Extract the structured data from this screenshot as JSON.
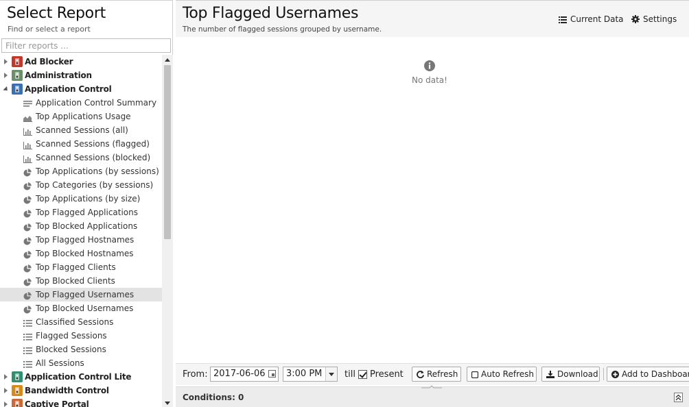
{
  "left": {
    "title": "Select Report",
    "subtitle": "Find or select a report",
    "filter_placeholder": "Filter reports ..."
  },
  "tree": [
    {
      "type": "group",
      "label": "Ad Blocker",
      "expanded": false,
      "icon": "ad-blocker-icon",
      "color": "#c0392b"
    },
    {
      "type": "group",
      "label": "Administration",
      "expanded": false,
      "icon": "administration-icon",
      "color": "#6b8e6b"
    },
    {
      "type": "group",
      "label": "Application Control",
      "expanded": true,
      "icon": "application-control-icon",
      "color": "#3a6fb0"
    },
    {
      "type": "report",
      "label": "Application Control Summary",
      "icon": "text-report-icon"
    },
    {
      "type": "report",
      "label": "Top Applications Usage",
      "icon": "area-chart-icon"
    },
    {
      "type": "report",
      "label": "Scanned Sessions (all)",
      "icon": "bar-chart-icon"
    },
    {
      "type": "report",
      "label": "Scanned Sessions (flagged)",
      "icon": "bar-chart-icon"
    },
    {
      "type": "report",
      "label": "Scanned Sessions (blocked)",
      "icon": "bar-chart-icon"
    },
    {
      "type": "report",
      "label": "Top Applications (by sessions)",
      "icon": "pie-chart-icon"
    },
    {
      "type": "report",
      "label": "Top Categories (by sessions)",
      "icon": "pie-chart-icon"
    },
    {
      "type": "report",
      "label": "Top Applications (by size)",
      "icon": "pie-chart-icon"
    },
    {
      "type": "report",
      "label": "Top Flagged Applications",
      "icon": "pie-chart-icon"
    },
    {
      "type": "report",
      "label": "Top Blocked Applications",
      "icon": "pie-chart-icon"
    },
    {
      "type": "report",
      "label": "Top Flagged Hostnames",
      "icon": "pie-chart-icon"
    },
    {
      "type": "report",
      "label": "Top Blocked Hostnames",
      "icon": "pie-chart-icon"
    },
    {
      "type": "report",
      "label": "Top Flagged Clients",
      "icon": "pie-chart-icon"
    },
    {
      "type": "report",
      "label": "Top Blocked Clients",
      "icon": "pie-chart-icon"
    },
    {
      "type": "report",
      "label": "Top Flagged Usernames",
      "icon": "pie-chart-icon",
      "selected": true
    },
    {
      "type": "report",
      "label": "Top Blocked Usernames",
      "icon": "pie-chart-icon"
    },
    {
      "type": "report",
      "label": "Classified Sessions",
      "icon": "list-icon"
    },
    {
      "type": "report",
      "label": "Flagged Sessions",
      "icon": "list-icon"
    },
    {
      "type": "report",
      "label": "Blocked Sessions",
      "icon": "list-icon"
    },
    {
      "type": "report",
      "label": "All Sessions",
      "icon": "list-icon"
    },
    {
      "type": "group",
      "label": "Application Control Lite",
      "expanded": false,
      "icon": "application-control-lite-icon",
      "color": "#2f8f6f"
    },
    {
      "type": "group",
      "label": "Bandwidth Control",
      "expanded": false,
      "icon": "bandwidth-control-icon",
      "color": "#d68a1c"
    },
    {
      "type": "group",
      "label": "Captive Portal",
      "expanded": false,
      "icon": "captive-portal-icon",
      "color": "#c86a3a"
    }
  ],
  "report": {
    "title": "Top Flagged Usernames",
    "description": "The number of flagged sessions grouped by username.",
    "current_data_label": "Current Data",
    "settings_label": "Settings",
    "no_data": "No data!"
  },
  "toolbar": {
    "from_label": "From:",
    "date_value": "2017-06-06",
    "time_value": "3:00 PM",
    "till_label": "till",
    "present_label": "Present",
    "present_checked": true,
    "refresh_label": "Refresh",
    "auto_refresh_label": "Auto Refresh",
    "download_label": "Download",
    "add_dashboard_label": "Add to Dashboard"
  },
  "conditions": {
    "label": "Conditions: 0"
  }
}
